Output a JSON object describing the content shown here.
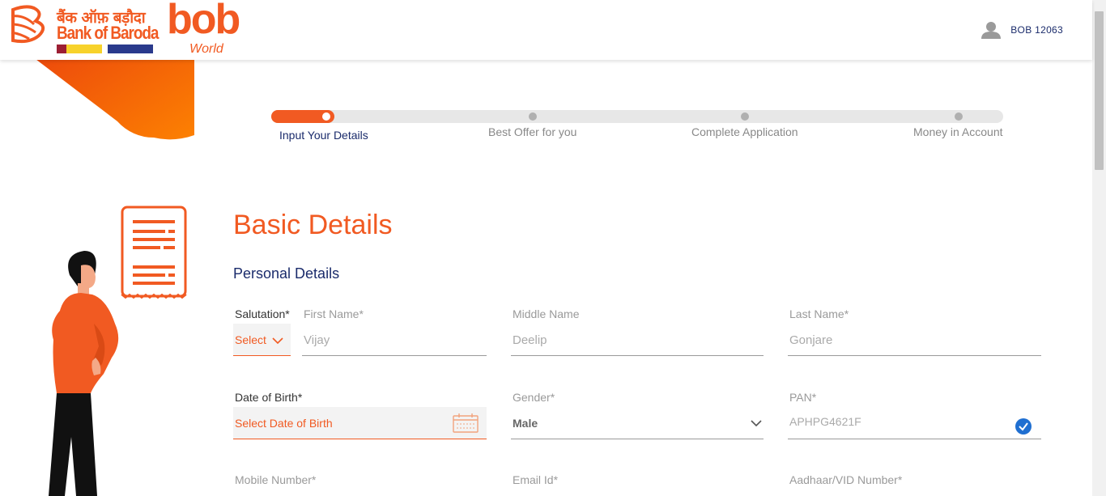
{
  "header": {
    "logo": {
      "hindi_text": "बैंक ऑफ़ बड़ौदा",
      "english_text": "Bank of Baroda",
      "bob_text": "bob",
      "world_text": "World"
    },
    "user_id": "BOB 12063"
  },
  "stepper": {
    "steps": [
      {
        "label": "Input Your Details",
        "active": true
      },
      {
        "label": "Best Offer for you",
        "active": false
      },
      {
        "label": "Complete Application",
        "active": false
      },
      {
        "label": "Money in Account",
        "active": false
      }
    ]
  },
  "form": {
    "title": "Basic Details",
    "section_title": "Personal Details",
    "salutation": {
      "label": "Salutation*",
      "value": "Select"
    },
    "first_name": {
      "label": "First Name*",
      "value": "Vijay"
    },
    "middle_name": {
      "label": "Middle Name",
      "value": "Deelip"
    },
    "last_name": {
      "label": "Last Name*",
      "value": "Gonjare"
    },
    "dob": {
      "label": "Date of Birth*",
      "placeholder": "Select Date of Birth"
    },
    "gender": {
      "label": "Gender*",
      "value": "Male"
    },
    "pan": {
      "label": "PAN*",
      "value": "APHPG4621F"
    },
    "mobile": {
      "label": "Mobile Number*"
    },
    "email": {
      "label": "Email Id*"
    },
    "aadhaar": {
      "label": "Aadhaar/VID Number*"
    }
  },
  "colors": {
    "brand_orange": "#f15a22",
    "navy": "#1a2b6b",
    "verified_blue": "#1f6fd1"
  },
  "icons": [
    "bank-of-baroda-logo-icon",
    "user-avatar-icon",
    "chevron-down-icon",
    "calendar-icon",
    "verified-check-icon",
    "document-illustration-icon",
    "person-illustration-icon"
  ]
}
